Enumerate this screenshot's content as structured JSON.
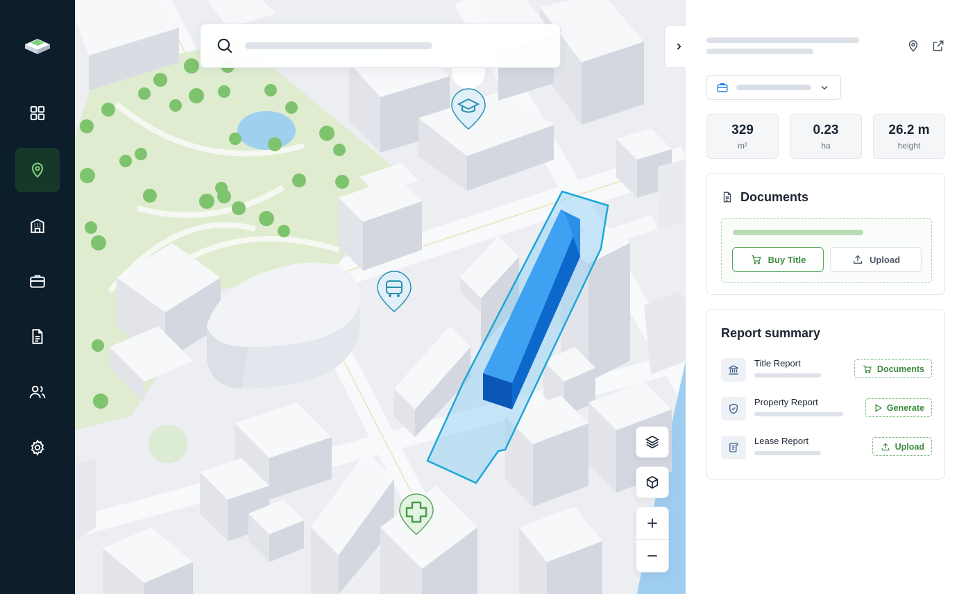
{
  "sidebar": {
    "logo": "stack-logo",
    "items": [
      {
        "name": "dashboard",
        "icon": "grid-icon",
        "active": false
      },
      {
        "name": "map",
        "icon": "location-pin-icon",
        "active": true
      },
      {
        "name": "buildings",
        "icon": "building-icon",
        "active": false
      },
      {
        "name": "portfolio",
        "icon": "briefcase-icon",
        "active": false
      },
      {
        "name": "documents",
        "icon": "document-icon",
        "active": false
      },
      {
        "name": "users",
        "icon": "users-icon",
        "active": false
      },
      {
        "name": "settings",
        "icon": "gear-icon",
        "active": false
      }
    ]
  },
  "map": {
    "markers": [
      {
        "type": "school",
        "icon": "graduation-cap-icon"
      },
      {
        "type": "bus",
        "icon": "bus-icon"
      },
      {
        "type": "hospital",
        "icon": "medical-cross-icon"
      }
    ],
    "controls": [
      "layers-icon",
      "cube-icon",
      "zoom-in-icon",
      "zoom-out-icon"
    ]
  },
  "stats": [
    {
      "value": "329",
      "unit": "m²"
    },
    {
      "value": "0.23",
      "unit": "ha"
    },
    {
      "value": "26.2 m",
      "unit": "height"
    }
  ],
  "documents": {
    "title": "Documents",
    "buy_label": "Buy Title",
    "upload_label": "Upload"
  },
  "report": {
    "title": "Report summary",
    "rows": [
      {
        "name": "Title Report",
        "action": "Documents",
        "icon": "bank-icon",
        "action_icon": "cart-icon"
      },
      {
        "name": "Property Report",
        "action": "Generate",
        "icon": "shield-icon",
        "action_icon": "play-icon"
      },
      {
        "name": "Lease Report",
        "action": "Upload",
        "icon": "scroll-icon",
        "action_icon": "upload-icon"
      }
    ]
  },
  "colors": {
    "sidebar_bg": "#0c1d2b",
    "active_nav": "#163828",
    "accent_green": "#3d8b40",
    "selected_building": "#1a7fe0",
    "parcel_outline": "#1aa7d8",
    "marker_teal": "#2c8fb0"
  }
}
